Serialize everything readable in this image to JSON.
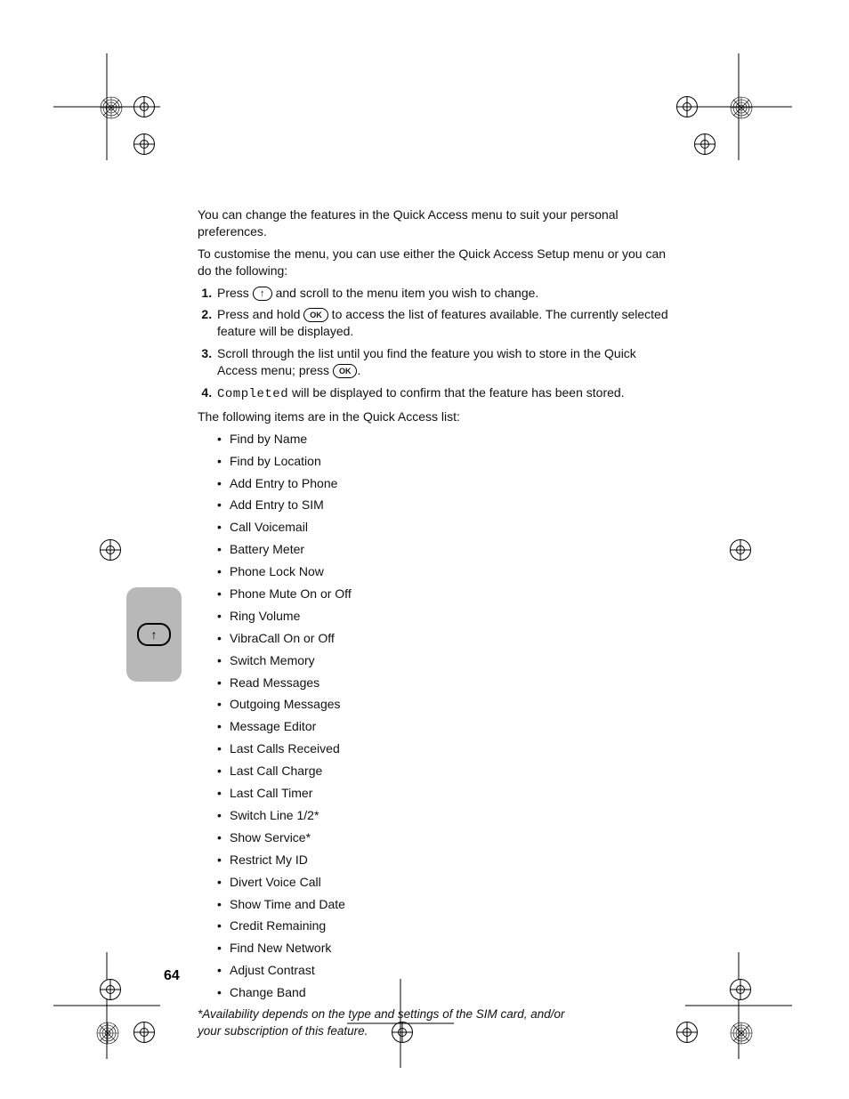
{
  "intro": [
    "You can change the features in the Quick Access menu to suit your personal preferences.",
    "To customise the menu, you can use either the Quick Access Setup menu or you can do the following:"
  ],
  "steps": {
    "s1a": "Press ",
    "s1b": " and scroll to the menu item you wish to change.",
    "s2a": "Press and hold ",
    "s2b": " to access the list of features available. The currently selected feature will be displayed.",
    "s3a": "Scroll through the list until you find the feature you wish to store in the Quick Access menu; press ",
    "s3b": ".",
    "s4a": "Completed",
    "s4b": " will be displayed to confirm that the feature has been stored."
  },
  "keys": {
    "ok": "OK"
  },
  "list_intro": "The following items are in the Quick Access list:",
  "items": [
    "Find by Name",
    "Find by Location",
    "Add Entry to Phone",
    "Add Entry to SIM",
    "Call Voicemail",
    "Battery Meter",
    "Phone Lock Now",
    "Phone Mute On or Off",
    "Ring Volume",
    "VibraCall On or Off",
    "Switch Memory",
    "Read Messages",
    "Outgoing Messages",
    "Message Editor",
    "Last Calls Received",
    "Last Call Charge",
    "Last Call Timer",
    "Switch Line 1/2*",
    "Show Service*",
    "Restrict My ID",
    "Divert Voice Call",
    "Show Time and Date",
    "Credit Remaining",
    "Find New Network",
    "Adjust Contrast",
    "Change Band"
  ],
  "footnote": "*Availability depends on the type and settings of the SIM card, and/or your subscription of this feature.",
  "tab_icon": "↑",
  "page_number": "64"
}
